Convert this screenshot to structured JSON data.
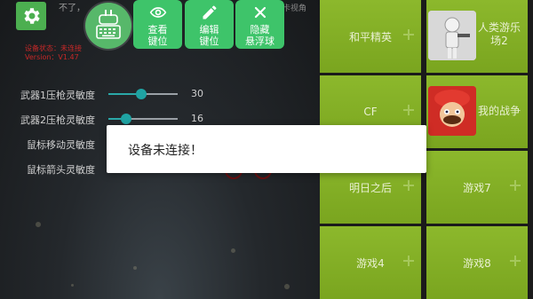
{
  "top": {
    "hint_left": "不了，",
    "hint_right": "卡视角"
  },
  "status": {
    "line1": "设备状态：未连接",
    "line2": "Version：V1.47"
  },
  "toolbar": {
    "view_keys": "查看\n键位",
    "view_keys_line1": "查看",
    "view_keys_line2": "键位",
    "edit_keys_line1": "编辑",
    "edit_keys_line2": "键位",
    "hide_ball_line1": "隐藏",
    "hide_ball_line2": "悬浮球"
  },
  "sliders": [
    {
      "label": "武器1压枪灵敏度",
      "value": "30",
      "fraction": 0.47
    },
    {
      "label": "武器2压枪灵敏度",
      "value": "16",
      "fraction": 0.25
    },
    {
      "label": "鼠标移动灵敏度",
      "value": "",
      "fraction": 0.4
    },
    {
      "label": "鼠标箭头灵敏度",
      "value": "",
      "fraction": 0.4
    }
  ],
  "games": [
    {
      "label": "和平精英"
    },
    {
      "label": "人类游乐场2"
    },
    {
      "label": "CF"
    },
    {
      "label": "我的战争"
    },
    {
      "label": "明日之后"
    },
    {
      "label": "游戏7"
    },
    {
      "label": "游戏4"
    },
    {
      "label": "游戏8"
    }
  ],
  "dialog": {
    "message": "设备未连接！"
  },
  "colors": {
    "accent_green": "#3ec46a",
    "tile_green": "#8cb82c",
    "slider_teal": "#1fa3a3",
    "status_red": "#c62828"
  },
  "icons": {
    "settings": "gear-icon",
    "float_ball": "keyboard-joystick-icon",
    "view": "eye-icon",
    "edit": "pencil-icon",
    "hide": "close-icon"
  }
}
